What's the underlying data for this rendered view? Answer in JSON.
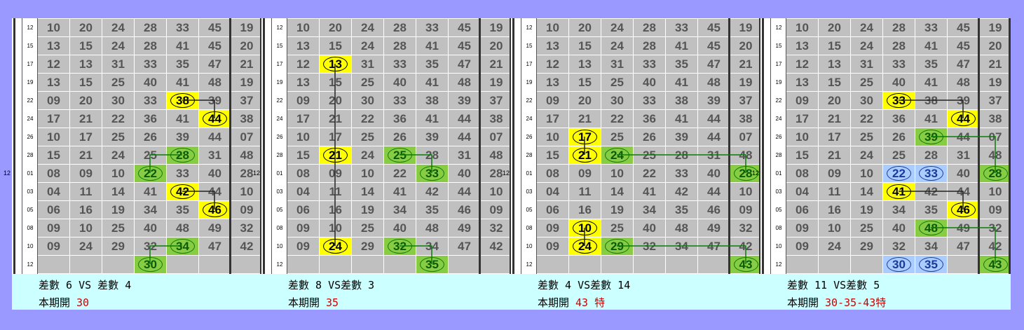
{
  "row_labels": [
    "12",
    "15",
    "17",
    "19",
    "22",
    "24",
    "26",
    "28",
    "01",
    "03",
    "05",
    "08",
    "10",
    "12"
  ],
  "month_label": "12",
  "grid": [
    [
      "10",
      "20",
      "24",
      "28",
      "33",
      "45",
      "19"
    ],
    [
      "13",
      "15",
      "24",
      "28",
      "41",
      "45",
      "20"
    ],
    [
      "12",
      "13",
      "31",
      "33",
      "35",
      "47",
      "21"
    ],
    [
      "13",
      "15",
      "25",
      "40",
      "41",
      "48",
      "19"
    ],
    [
      "09",
      "20",
      "30",
      "33",
      "38",
      "39",
      "37"
    ],
    [
      "17",
      "21",
      "22",
      "36",
      "41",
      "44",
      "38"
    ],
    [
      "10",
      "17",
      "25",
      "26",
      "39",
      "44",
      "07"
    ],
    [
      "15",
      "21",
      "24",
      "25",
      "28",
      "31",
      "48"
    ],
    [
      "08",
      "09",
      "10",
      "22",
      "33",
      "40",
      "28"
    ],
    [
      "04",
      "11",
      "14",
      "41",
      "42",
      "44",
      "10"
    ],
    [
      "06",
      "16",
      "19",
      "34",
      "35",
      "46",
      "09"
    ],
    [
      "09",
      "10",
      "25",
      "40",
      "48",
      "49",
      "32"
    ],
    [
      "09",
      "24",
      "29",
      "32",
      "34",
      "47",
      "42"
    ],
    [
      "",
      "",
      "",
      "",
      "",
      "",
      ""
    ]
  ],
  "panels": [
    {
      "highlights": [
        {
          "row": 4,
          "col": 4,
          "c": "y",
          "val": "38"
        },
        {
          "row": 5,
          "col": 5,
          "c": "y",
          "val": "44"
        },
        {
          "row": 7,
          "col": 4,
          "c": "g",
          "val": "28"
        },
        {
          "row": 8,
          "col": 3,
          "c": "g",
          "val": "22"
        },
        {
          "row": 9,
          "col": 4,
          "c": "y",
          "val": "42"
        },
        {
          "row": 10,
          "col": 5,
          "c": "y",
          "val": "46"
        },
        {
          "row": 12,
          "col": 4,
          "c": "g",
          "val": "34"
        },
        {
          "row": 13,
          "col": 3,
          "c": "g",
          "val": "30"
        }
      ],
      "links": [
        [
          "4-4",
          "5-5",
          "k"
        ],
        [
          "7-4",
          "8-3",
          "g"
        ],
        [
          "9-4",
          "10-5",
          "k"
        ],
        [
          "12-4",
          "13-3",
          "g"
        ]
      ],
      "line1": "差數 6 VS 差數 4",
      "line2_prefix": "本期開 ",
      "line2_value": "30"
    },
    {
      "highlights": [
        {
          "row": 2,
          "col": 1,
          "c": "y",
          "val": "13"
        },
        {
          "row": 7,
          "col": 1,
          "c": "y",
          "val": "21"
        },
        {
          "row": 7,
          "col": 3,
          "c": "g",
          "val": "25"
        },
        {
          "row": 8,
          "col": 4,
          "c": "g",
          "val": "33"
        },
        {
          "row": 12,
          "col": 1,
          "c": "y",
          "val": "24"
        },
        {
          "row": 12,
          "col": 3,
          "c": "g",
          "val": "32"
        },
        {
          "row": 13,
          "col": 4,
          "c": "g",
          "val": "35"
        }
      ],
      "links": [
        [
          "2-1",
          "7-1",
          "k"
        ],
        [
          "7-1",
          "12-1",
          "k"
        ],
        [
          "7-3",
          "8-4",
          "g"
        ],
        [
          "12-3",
          "13-4",
          "g"
        ]
      ],
      "line1": "差數 8 VS差數 3",
      "line2_prefix": "本期開 ",
      "line2_value": "35"
    },
    {
      "highlights": [
        {
          "row": 6,
          "col": 1,
          "c": "y",
          "val": "17"
        },
        {
          "row": 7,
          "col": 1,
          "c": "y",
          "val": "21"
        },
        {
          "row": 7,
          "col": 2,
          "c": "g",
          "val": "24"
        },
        {
          "row": 8,
          "col": 6,
          "c": "g",
          "val": "28"
        },
        {
          "row": 11,
          "col": 1,
          "c": "y",
          "val": "10"
        },
        {
          "row": 12,
          "col": 1,
          "c": "y",
          "val": "24"
        },
        {
          "row": 12,
          "col": 2,
          "c": "g",
          "val": "29"
        },
        {
          "row": 13,
          "col": 6,
          "c": "g",
          "val": "43"
        }
      ],
      "links": [
        [
          "6-1",
          "7-1",
          "k"
        ],
        [
          "11-1",
          "12-1",
          "k"
        ],
        [
          "7-2",
          "8-6",
          "g"
        ],
        [
          "12-2",
          "13-6",
          "g"
        ]
      ],
      "line1": "差數 4 VS差數 14",
      "line2_prefix": "本期開 ",
      "line2_value": "43 特"
    },
    {
      "highlights": [
        {
          "row": 4,
          "col": 3,
          "c": "y",
          "val": "33"
        },
        {
          "row": 5,
          "col": 5,
          "c": "y",
          "val": "44"
        },
        {
          "row": 6,
          "col": 4,
          "c": "g",
          "val": "39"
        },
        {
          "row": 8,
          "col": 6,
          "c": "g",
          "val": "28"
        },
        {
          "row": 8,
          "col": 3,
          "c": "b",
          "val": "22"
        },
        {
          "row": 8,
          "col": 4,
          "c": "b",
          "val": "33"
        },
        {
          "row": 9,
          "col": 3,
          "c": "y",
          "val": "41"
        },
        {
          "row": 10,
          "col": 5,
          "c": "y",
          "val": "46"
        },
        {
          "row": 11,
          "col": 4,
          "c": "g",
          "val": "48"
        },
        {
          "row": 13,
          "col": 6,
          "c": "g",
          "val": "43"
        },
        {
          "row": 13,
          "col": 3,
          "c": "b",
          "val": "30"
        },
        {
          "row": 13,
          "col": 4,
          "c": "b",
          "val": "35"
        }
      ],
      "links": [
        [
          "4-3",
          "5-5",
          "k"
        ],
        [
          "6-4",
          "8-6",
          "g"
        ],
        [
          "9-3",
          "10-5",
          "k"
        ],
        [
          "11-4",
          "13-6",
          "g"
        ]
      ],
      "line1": "差數 11 VS差數 5",
      "line2_prefix": "本期開 ",
      "line2_value": "30-35-43特"
    }
  ]
}
